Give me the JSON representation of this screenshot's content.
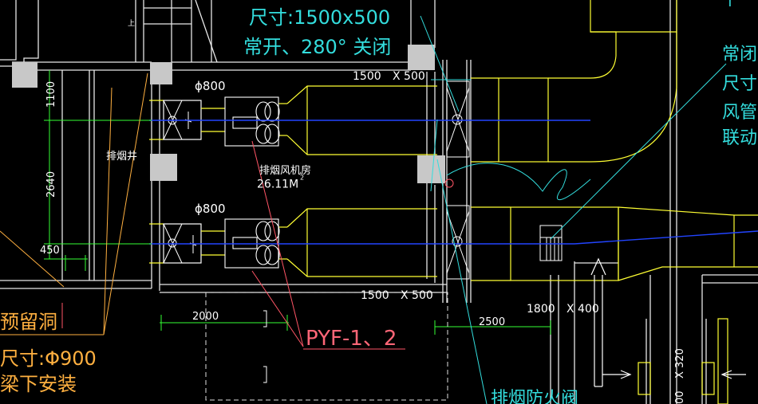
{
  "notes": {
    "top_size": "尺寸:1500x500",
    "top_spec": "常开、280° 关闭",
    "right_1": "常闭多",
    "right_2": "尺寸:",
    "right_3": "风管上",
    "right_4": "联动排",
    "right_top": "T"
  },
  "labels": {
    "shaft": "排烟井",
    "room_name": "排烟风机房",
    "room_area": "26.11M",
    "room_area_sup": "2",
    "shaft_marker": "上",
    "fan_tag": "PYF-1、2",
    "reserved_hole": "预留洞",
    "hole_size": "尺寸:Φ900",
    "hole_install": "梁下安装",
    "bottom_right": "排烟防火阀"
  },
  "dimensions": {
    "phi_top": "ϕ800",
    "phi_bottom": "ϕ800",
    "duct_top_w": "1500",
    "duct_top_h": "X 500",
    "duct_bottom_w": "1500",
    "duct_bottom_h": "X 500",
    "duct_right_w": "1800",
    "duct_right_h": "X 400",
    "dim_1100": "1100",
    "dim_2640": "2640",
    "dim_450": "450",
    "dim_2000": "2000",
    "dim_2500": "2500",
    "dim_320": "X 320",
    "dim_00": "00"
  }
}
